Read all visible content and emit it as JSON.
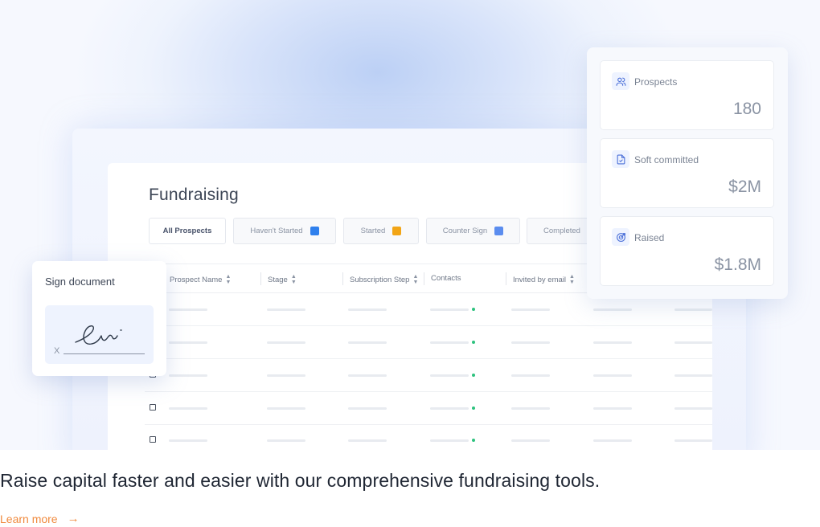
{
  "panel": {
    "title": "Fundraising",
    "tabs": [
      {
        "label": "All Prospects"
      },
      {
        "label": "Haven't Started",
        "color": "#2f80ed"
      },
      {
        "label": "Started",
        "color": "#f2a516"
      },
      {
        "label": "Counter Sign",
        "color": "#5b8def"
      },
      {
        "label": "Completed"
      }
    ],
    "columns": [
      "Prospect Name",
      "Stage",
      "Subscription Step",
      "Contacts",
      "Invited by email"
    ],
    "status_dot_color": "#2ec27e"
  },
  "stats": [
    {
      "label": "Prospects",
      "value": "180",
      "icon": "users-icon"
    },
    {
      "label": "Soft committed",
      "value": "$2M",
      "icon": "document-check-icon"
    },
    {
      "label": "Raised",
      "value": "$1.8M",
      "icon": "target-icon"
    }
  ],
  "sign": {
    "title": "Sign document",
    "x_mark": "X"
  },
  "footer": {
    "tagline": "Raise capital faster and easier with our comprehensive fundraising tools.",
    "link": "Learn more",
    "accent": "#f08a3e"
  }
}
